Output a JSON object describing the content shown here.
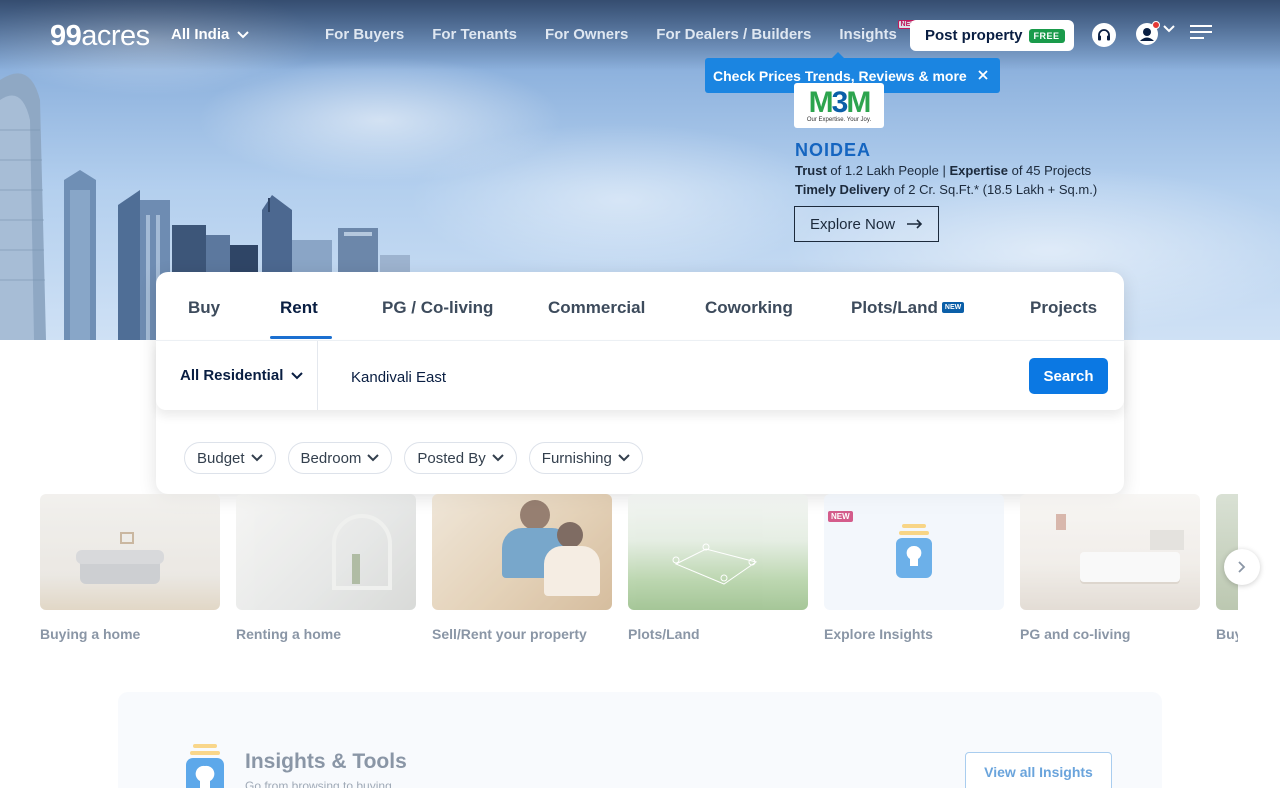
{
  "header": {
    "logo_number": "99",
    "logo_word": "acres",
    "city": "All India",
    "nav": [
      {
        "label": "For Buyers"
      },
      {
        "label": "For Tenants"
      },
      {
        "label": "For Owners"
      },
      {
        "label": "For Dealers / Builders"
      },
      {
        "label": "Insights",
        "badge": "NEW"
      }
    ],
    "post_property": "Post property",
    "post_badge": "FREE"
  },
  "tooltip": {
    "text": "Check Prices Trends, Reviews & more"
  },
  "ad": {
    "logo_mark_a": "M",
    "logo_mark_b": "3",
    "logo_mark_c": "M",
    "logo_tagline": "Our Expertise. Your Joy.",
    "title": "NOIDEA",
    "line1_b1": "Trust",
    "line1_t1": " of 1.2 Lakh People | ",
    "line1_b2": "Expertise",
    "line1_t2": " of 45 Projects",
    "line2_b1": "Timely Delivery",
    "line2_t1": " of 2 Cr. Sq.Ft.* (18.5 Lakh + Sq.m.)",
    "cta": "Explore Now"
  },
  "search": {
    "tabs": [
      {
        "label": "Buy"
      },
      {
        "label": "Rent",
        "active": true
      },
      {
        "label": "PG / Co-living"
      },
      {
        "label": "Commercial"
      },
      {
        "label": "Coworking"
      },
      {
        "label": "Plots/Land",
        "badge": "NEW"
      },
      {
        "label": "Projects"
      }
    ],
    "property_type": "All Residential",
    "query": "Kandivali East",
    "button": "Search",
    "filters": [
      {
        "label": "Budget"
      },
      {
        "label": "Bedroom"
      },
      {
        "label": "Posted By"
      },
      {
        "label": "Furnishing"
      }
    ]
  },
  "categories": [
    {
      "label": "Buying a home"
    },
    {
      "label": "Renting a home"
    },
    {
      "label": "Sell/Rent your property"
    },
    {
      "label": "Plots/Land"
    },
    {
      "label": "Explore Insights",
      "badge": "NEW"
    },
    {
      "label": "PG and co-living"
    },
    {
      "label": "Buy"
    }
  ],
  "insights": {
    "title": "Insights & Tools",
    "subtitle": "Go from browsing to buying",
    "view_all": "View all Insights"
  },
  "colors": {
    "brand_blue": "#0b78e3",
    "tooltip_blue": "#1b85e1",
    "free_green": "#1a9b4b",
    "new_pink": "#c2185b"
  }
}
